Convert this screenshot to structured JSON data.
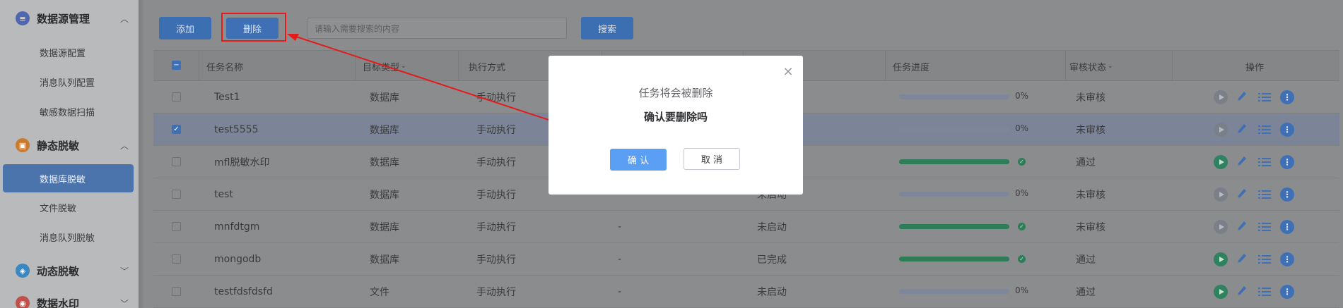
{
  "sidebar": {
    "groups": [
      {
        "label": "数据源管理",
        "icon": "database-icon",
        "chevron": "^",
        "color": "#5066b0"
      },
      {
        "label": "静态脱敏",
        "icon": "lock-icon",
        "chevron": "^",
        "color": "#c97a2e"
      },
      {
        "label": "动态脱敏",
        "icon": "shield-icon",
        "chevron": "v",
        "color": "#3a87c2"
      },
      {
        "label": "数据水印",
        "icon": "watermark-icon",
        "chevron": "v",
        "color": "#c2504a"
      }
    ],
    "items": [
      {
        "label": "数据源配置"
      },
      {
        "label": "消息队列配置"
      },
      {
        "label": "敏感数据扫描"
      },
      {
        "label": "数据库脱敏",
        "active": true
      },
      {
        "label": "文件脱敏"
      },
      {
        "label": "消息队列脱敏"
      }
    ]
  },
  "toolbar": {
    "add_label": "添加",
    "delete_label": "删除",
    "search_placeholder": "请输入需要搜索的内容",
    "search_label": "搜索"
  },
  "table": {
    "headers": [
      "任务名称",
      "目标类型",
      "执行方式",
      "",
      "",
      "任务进度",
      "审核状态",
      "操作"
    ],
    "rows": [
      {
        "name": "Test1",
        "target": "数据库",
        "mode": "手动执行",
        "col4": "",
        "col5": "",
        "progress": 0,
        "progress_text": "0%",
        "audit": "未审核",
        "checked": false,
        "play_enabled": false
      },
      {
        "name": "test5555",
        "target": "数据库",
        "mode": "手动执行",
        "col4": "",
        "col5": "",
        "progress": 0,
        "progress_text": "0%",
        "audit": "未审核",
        "checked": true,
        "play_enabled": false
      },
      {
        "name": "mfl脱敏水印",
        "target": "数据库",
        "mode": "手动执行",
        "col4": "",
        "col5": "",
        "progress": 100,
        "progress_text": "",
        "audit": "通过",
        "checked": false,
        "play_enabled": true
      },
      {
        "name": "test",
        "target": "数据库",
        "mode": "手动执行",
        "col4": "",
        "col5": "未启动",
        "progress": 0,
        "progress_text": "0%",
        "audit": "未审核",
        "checked": false,
        "play_enabled": false
      },
      {
        "name": "mnfdtgm",
        "target": "数据库",
        "mode": "手动执行",
        "col4": "-",
        "col5": "未启动",
        "progress": 100,
        "progress_text": "",
        "audit": "未审核",
        "checked": false,
        "play_enabled": false
      },
      {
        "name": "mongodb",
        "target": "数据库",
        "mode": "手动执行",
        "col4": "-",
        "col5": "已完成",
        "progress": 100,
        "progress_text": "",
        "audit": "通过",
        "checked": false,
        "play_enabled": true
      },
      {
        "name": "testfdsfdsfd",
        "target": "文件",
        "mode": "手动执行",
        "col4": "-",
        "col5": "未启动",
        "progress": 0,
        "progress_text": "0%",
        "audit": "通过",
        "checked": false,
        "play_enabled": true
      }
    ]
  },
  "modal": {
    "message": "任务将会被删除",
    "question": "确认要删除吗",
    "confirm_label": "确 认",
    "cancel_label": "取 消",
    "close_glyph": "×"
  },
  "colors": {
    "primary": "#5b9ff5",
    "success": "#3fbf80",
    "annotation_red": "#e51b1b"
  }
}
